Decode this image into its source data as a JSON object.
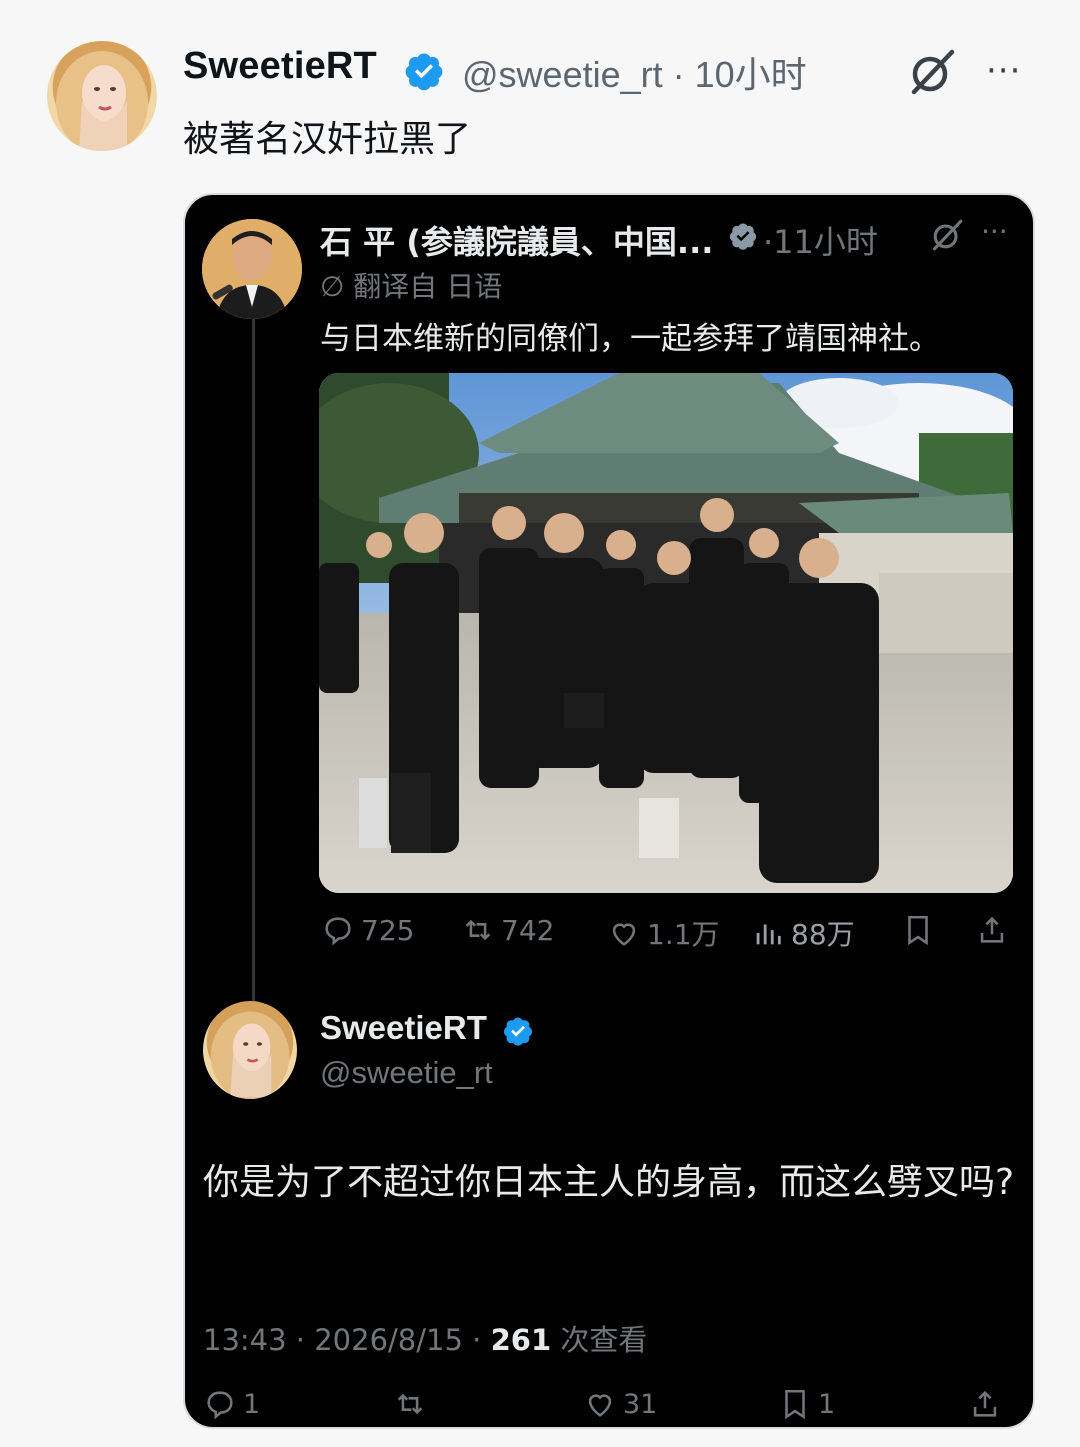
{
  "post": {
    "author_name": "SweetieRT",
    "handle_time": "@sweetie_rt · 10小时",
    "text": "被著名汉奸拉黑了",
    "more": "···"
  },
  "quoted": {
    "author_name": "石 平 (参議院議員、中国...",
    "time": "·11小时",
    "translated_label": "翻译自 日语",
    "text": "与日本维新的同僚们，一起参拜了靖国神社。",
    "more": "···",
    "stats": {
      "replies": "725",
      "reposts": "742",
      "likes": "1.1万",
      "views": "88万"
    }
  },
  "reply": {
    "author_name": "SweetieRT",
    "handle": "@sweetie_rt",
    "text": "你是为了不超过你日本主人的身高，而这么劈叉吗?",
    "timestamp": "13:43 · 2026/8/15 · ",
    "views_count": "261",
    "views_label": " 次查看",
    "stats": {
      "replies": "1",
      "likes": "31",
      "bookmarks": "1"
    }
  },
  "colors": {
    "verified_blue": "#1d9bf0",
    "dark_bg": "#000000",
    "muted_gray": "#71767b"
  }
}
